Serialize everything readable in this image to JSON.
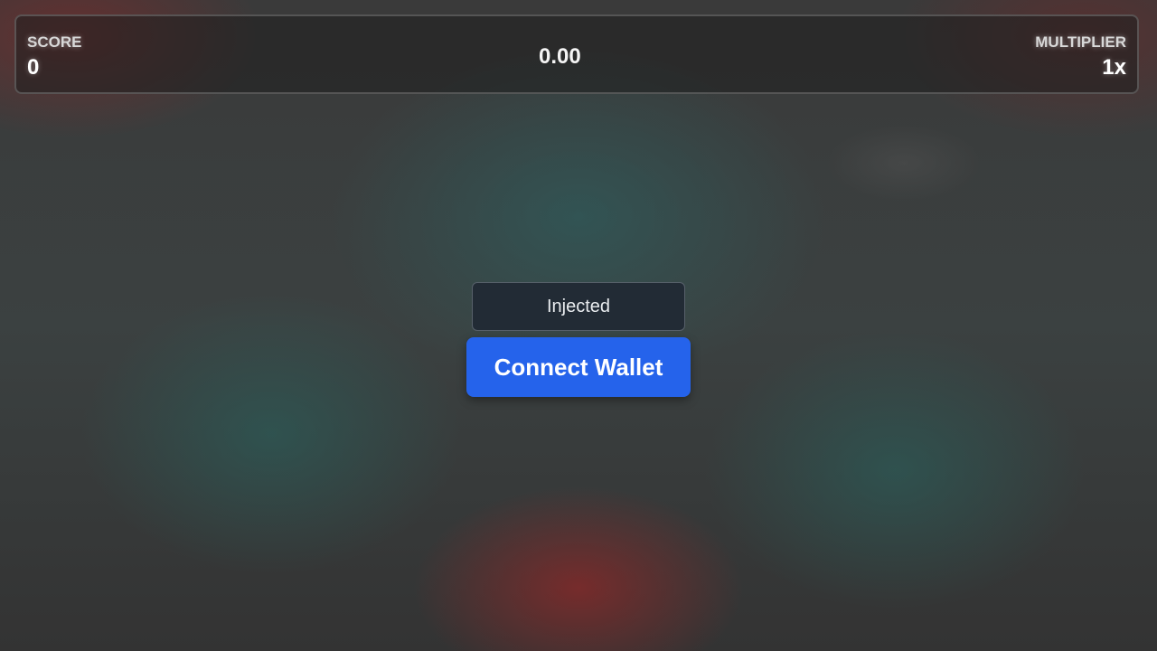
{
  "hud": {
    "score_label": "SCORE",
    "score_value": "0",
    "center_value": "0.00",
    "multiplier_label": "MULTIPLIER",
    "multiplier_value": "1x"
  },
  "wallet": {
    "selected_connector": "Injected",
    "connect_label": "Connect Wallet",
    "accent_color": "#2563eb"
  }
}
